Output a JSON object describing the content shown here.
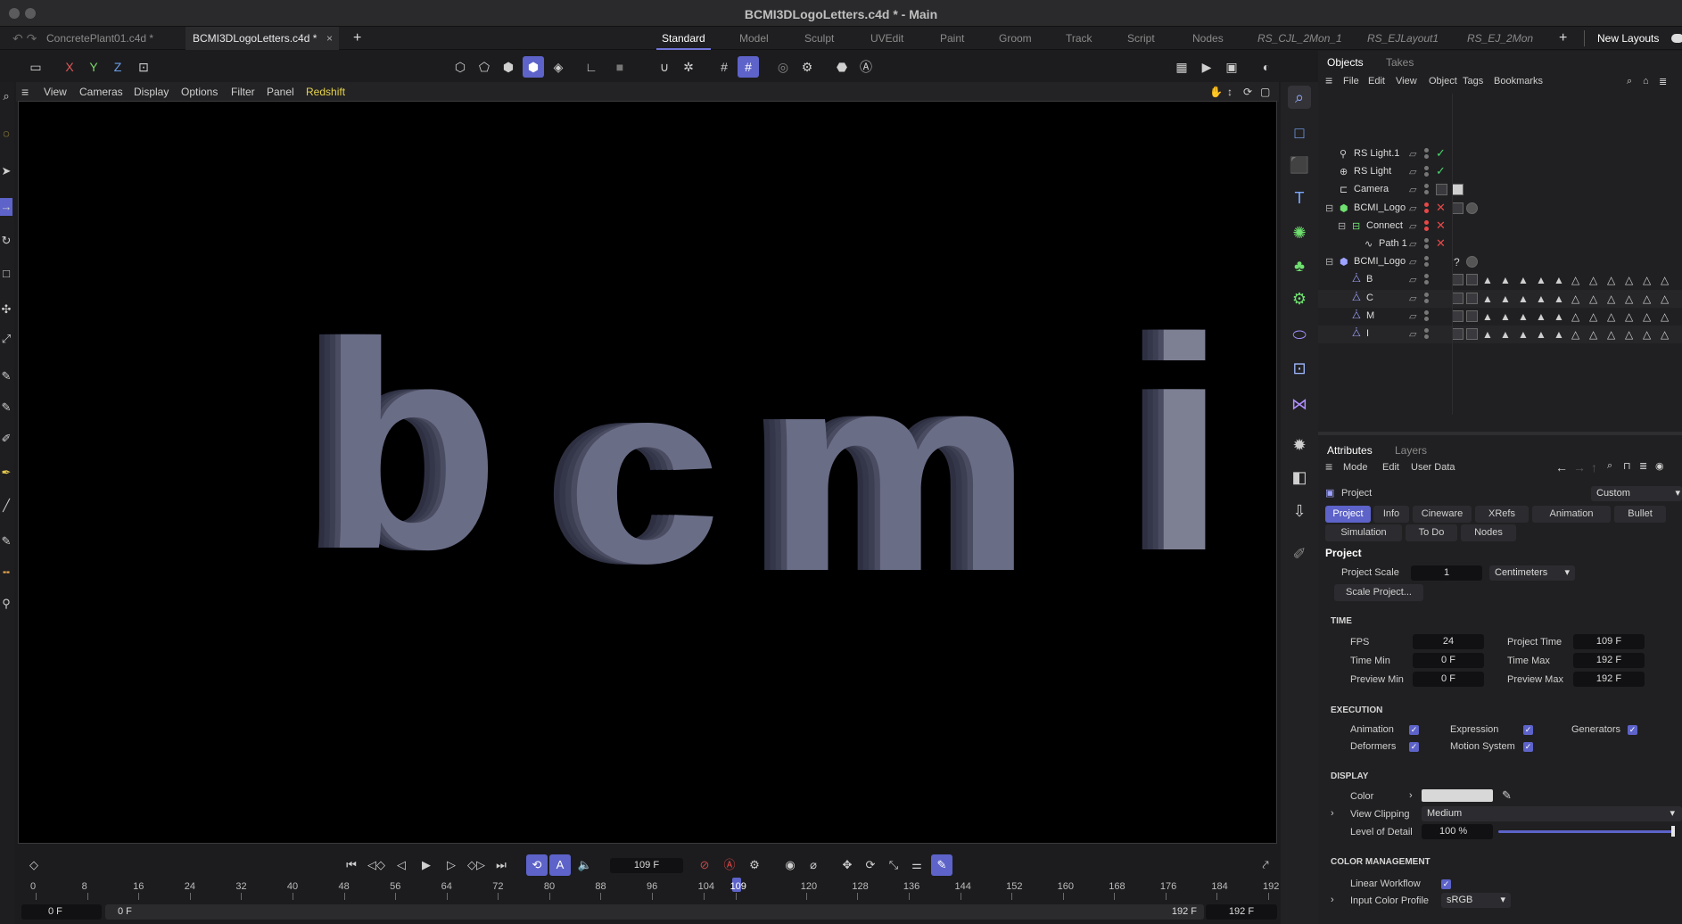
{
  "window": {
    "title": "BCMI3DLogoLetters.c4d * - Main"
  },
  "doc_tabs": [
    {
      "label": "ConcretePlant01.c4d *"
    },
    {
      "label": "BCMI3DLogoLetters.c4d *"
    }
  ],
  "layouts": [
    "Standard",
    "Model",
    "Sculpt",
    "UVEdit",
    "Paint",
    "Groom",
    "Track",
    "Script",
    "Nodes",
    "RS_CJL_2Mon_1",
    "RS_EJLayout1",
    "RS_EJ_2Mon"
  ],
  "new_layouts": "New Layouts",
  "axis": {
    "x": "X",
    "y": "Y",
    "z": "Z"
  },
  "viewport_menu": [
    "View",
    "Cameras",
    "Display",
    "Options",
    "Filter",
    "Panel",
    "Redshift"
  ],
  "viewport_letters": [
    "b",
    "c",
    "m",
    "i"
  ],
  "objects_panel": {
    "tabs": [
      "Objects",
      "Takes"
    ],
    "menu": [
      "File",
      "Edit",
      "View",
      "Object",
      "Tags",
      "Bookmarks"
    ],
    "rows": [
      {
        "name": "RS Light.1",
        "status": "check"
      },
      {
        "name": "RS Light",
        "status": "check"
      },
      {
        "name": "Camera",
        "status": "check"
      },
      {
        "name": "BCMI_Logo",
        "status": "cross"
      },
      {
        "name": "Connect",
        "status": "cross"
      },
      {
        "name": "Path 1",
        "status": "cross"
      },
      {
        "name": "BCMI_Logo",
        "status": "none"
      },
      {
        "name": "B",
        "status": "none"
      },
      {
        "name": "C",
        "status": "none"
      },
      {
        "name": "M",
        "status": "none"
      },
      {
        "name": "I",
        "status": "none"
      }
    ]
  },
  "attributes_panel": {
    "tabs": [
      "Attributes",
      "Layers"
    ],
    "menu": [
      "Mode",
      "Edit",
      "User Data"
    ],
    "object_label": "Project",
    "mode_value": "Custom",
    "buttons_row1": [
      "Project",
      "Info",
      "Cineware",
      "XRefs",
      "Animation",
      "Bullet"
    ],
    "buttons_row2": [
      "Simulation",
      "To Do",
      "Nodes"
    ],
    "heading": "Project",
    "project_scale_label": "Project Scale",
    "project_scale_value": "1",
    "project_scale_unit": "Centimeters",
    "scale_project_button": "Scale Project...",
    "time": {
      "section": "TIME",
      "fps_label": "FPS",
      "fps": "24",
      "project_time_label": "Project Time",
      "project_time": "109 F",
      "time_min_label": "Time Min",
      "time_min": "0 F",
      "time_max_label": "Time Max",
      "time_max": "192 F",
      "preview_min_label": "Preview Min",
      "preview_min": "0 F",
      "preview_max_label": "Preview Max",
      "preview_max": "192 F"
    },
    "execution": {
      "section": "EXECUTION",
      "animation": "Animation",
      "expression": "Expression",
      "generators": "Generators",
      "deformers": "Deformers",
      "motion_system": "Motion System"
    },
    "display": {
      "section": "DISPLAY",
      "color_label": "Color",
      "view_clipping_label": "View Clipping",
      "view_clipping": "Medium",
      "lod_label": "Level of Detail",
      "lod": "100 %"
    },
    "color_management": {
      "section": "COLOR MANAGEMENT",
      "linear_workflow": "Linear Workflow",
      "input_color_profile_label": "Input Color Profile",
      "input_color_profile": "sRGB"
    }
  },
  "timeline": {
    "current_frame": "109 F",
    "ticks": [
      "0",
      "8",
      "16",
      "24",
      "32",
      "40",
      "48",
      "56",
      "64",
      "72",
      "80",
      "88",
      "96",
      "104",
      "109",
      "120",
      "128",
      "136",
      "144",
      "152",
      "160",
      "168",
      "176",
      "184",
      "192"
    ],
    "range_start": "0 F",
    "range_start2": "0 F",
    "range_end": "192 F",
    "range_end2": "192 F"
  },
  "colors": {
    "accent": "#5d63c9",
    "check": "#4ad66d",
    "cross": "#e84848",
    "redshift_menu": "#e6d24a"
  }
}
